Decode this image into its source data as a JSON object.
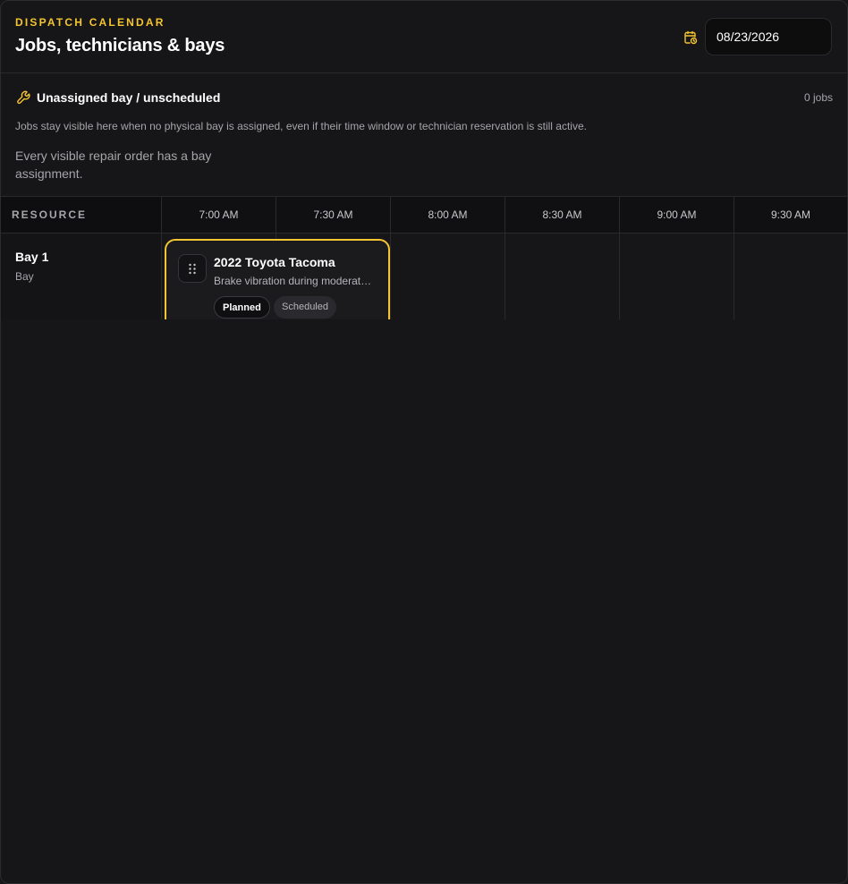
{
  "header": {
    "eyebrow": "DISPATCH CALENDAR",
    "title": "Jobs, technicians & bays",
    "date_value": "08/23/2026"
  },
  "unassigned": {
    "title": "Unassigned bay / unscheduled",
    "count": "0 jobs",
    "description": "Jobs stay visible here when no physical bay is assigned, even if their time window or technician reservation is still active.",
    "empty_message": "Every visible repair order has a bay assignment."
  },
  "grid": {
    "resource_header": "RESOURCE",
    "time_slots": [
      "7:00 AM",
      "7:30 AM",
      "8:00 AM",
      "8:30 AM",
      "9:00 AM",
      "9:30 AM"
    ],
    "rows": [
      {
        "name": "Bay 1",
        "type": "Bay",
        "job": {
          "title": "2022 Toyota Tacoma",
          "description": "Brake vibration during moderate braking",
          "status": "Planned",
          "tag": "Scheduled"
        }
      }
    ]
  },
  "colors": {
    "accent": "#f5c431",
    "background": "#161618"
  }
}
